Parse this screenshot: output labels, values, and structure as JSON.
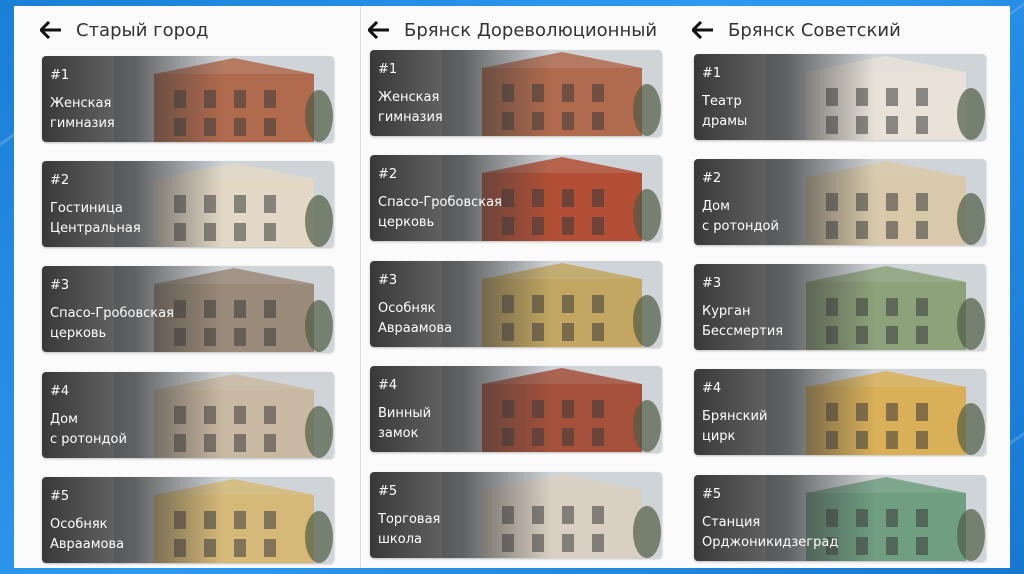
{
  "columns": [
    {
      "title": "Старый город",
      "items": [
        {
          "num": "#1",
          "name": "Женская\nгимназия",
          "color": "#b06a4d"
        },
        {
          "num": "#2",
          "name": "Гостиница\nЦентральная",
          "color": "#e3d8c6"
        },
        {
          "num": "#3",
          "name": "Спасо-Гробовская\nцерковь",
          "color": "#9a8a79"
        },
        {
          "num": "#4",
          "name": "Дом\nс ротондой",
          "color": "#c9b8a2"
        },
        {
          "num": "#5",
          "name": "Особняк\nАвраамова",
          "color": "#d6b978"
        }
      ]
    },
    {
      "title": "Брянск Дореволюционный",
      "items": [
        {
          "num": "#1",
          "name": "Женская\nгимназия",
          "color": "#b06a4d"
        },
        {
          "num": "#2",
          "name": "Спасо-Гробовская\nцерковь",
          "color": "#b24f36"
        },
        {
          "num": "#3",
          "name": "Особняк\nАвраамова",
          "color": "#c2a661"
        },
        {
          "num": "#4",
          "name": "Винный\nзамок",
          "color": "#a4503a"
        },
        {
          "num": "#5",
          "name": "Торговая\nшкола",
          "color": "#d9cfc2"
        }
      ]
    },
    {
      "title": "Брянск Советский",
      "items": [
        {
          "num": "#1",
          "name": "Театр\nдрамы",
          "color": "#e8e2d8"
        },
        {
          "num": "#2",
          "name": "Дом\nс ротондой",
          "color": "#d8c9aa"
        },
        {
          "num": "#3",
          "name": "Курган\nБессмертия",
          "color": "#8da27a"
        },
        {
          "num": "#4",
          "name": "Брянский\nцирк",
          "color": "#d9b058"
        },
        {
          "num": "#5",
          "name": "Станция\nОрджоникидзеград",
          "color": "#6f9e80"
        }
      ]
    }
  ]
}
